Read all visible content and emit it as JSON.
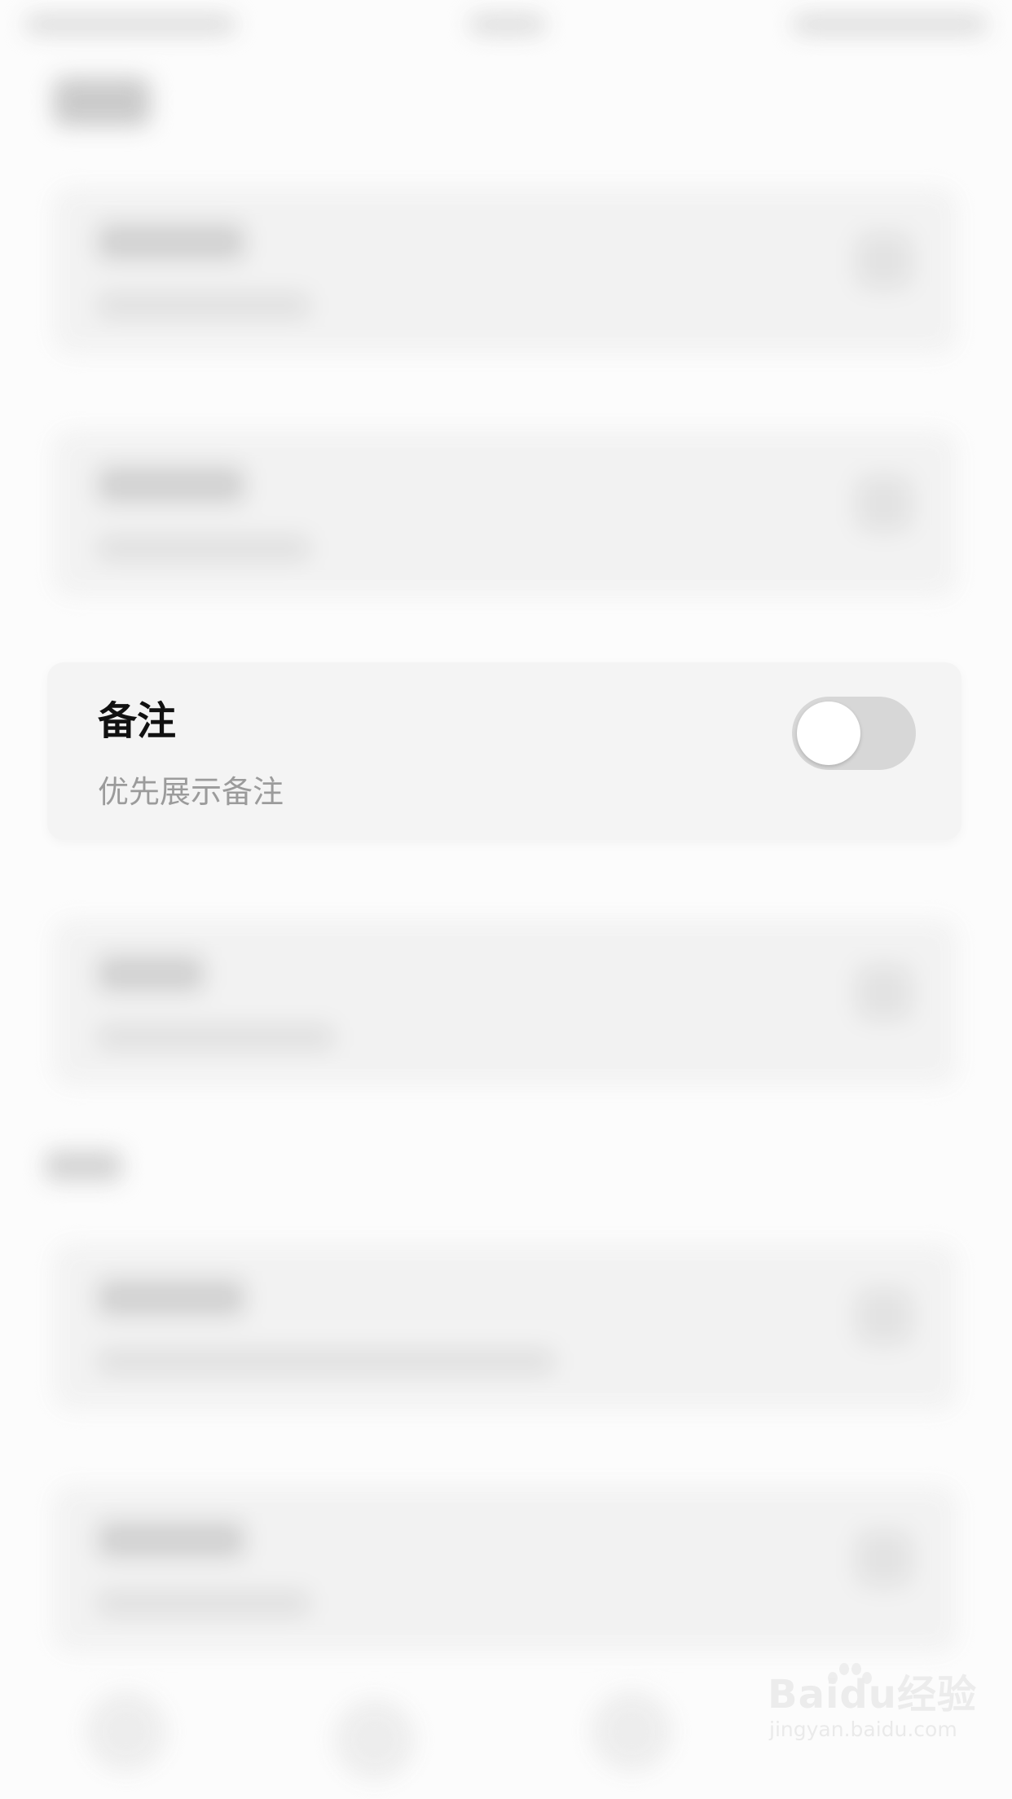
{
  "setting_card": {
    "title": "备注",
    "subtitle": "优先展示备注",
    "toggle_state": false
  },
  "watermark": {
    "line1": "Baidu经验",
    "line2": "jingyan.baidu.com"
  }
}
